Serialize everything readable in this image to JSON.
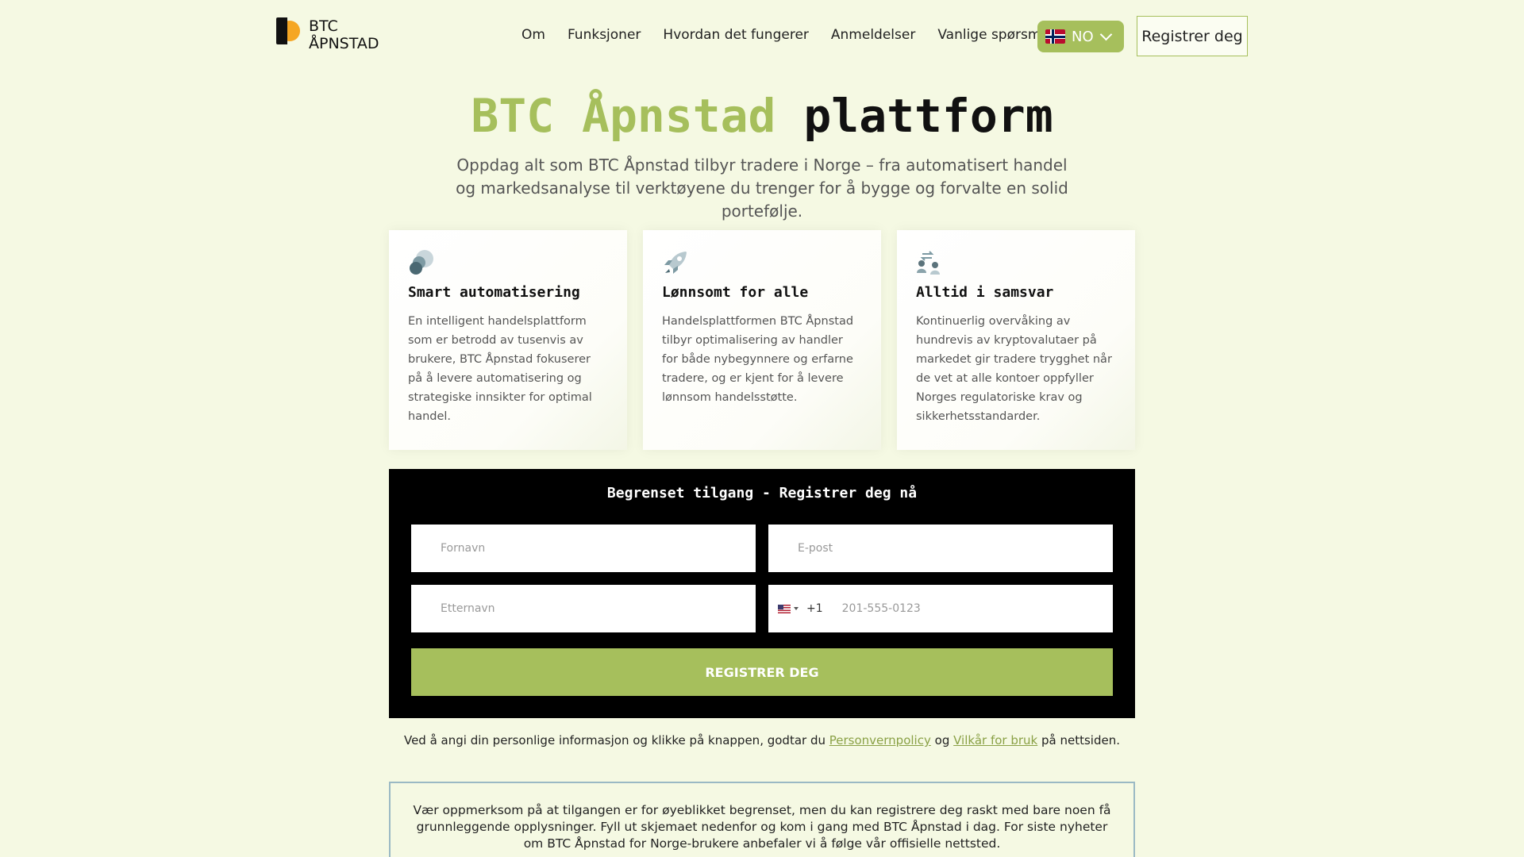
{
  "header": {
    "logo_line1": "BTC",
    "logo_line2": "ÅPNSTAD",
    "nav": [
      "Om",
      "Funksjoner",
      "Hvordan det fungerer",
      "Anmeldelser",
      "Vanlige spørsmål"
    ],
    "language": "NO",
    "register_label": "Registrer deg"
  },
  "hero": {
    "title_accent": "BTC Åpnstad",
    "title_rest": "plattform",
    "subtitle": "Oppdag alt som BTC Åpnstad tilbyr tradere i Norge – fra automatisert handel og markedsanalyse til verktøyene du trenger for å bygge og forvalte en solid portefølje."
  },
  "cards": [
    {
      "icon": "spheres-icon",
      "title": "Smart automatisering",
      "text": "En intelligent handelsplattform som er betrodd av tusenvis av brukere, BTC Åpnstad fokuserer på å levere automatisering og strategiske innsikter for optimal handel."
    },
    {
      "icon": "rocket-icon",
      "title": "Lønnsomt for alle",
      "text": "Handelsplattformen BTC Åpnstad tilbyr optimalisering av handler for både nybegynnere og erfarne tradere, og er kjent for å levere lønnsom handelsstøtte."
    },
    {
      "icon": "exchange-users-icon",
      "title": "Alltid i samsvar",
      "text": "Kontinuerlig overvåking av hundrevis av kryptovalutaer på markedet gir tradere trygghet når de vet at alle kontoer oppfyller Norges regulatoriske krav og sikkerhetsstandarder."
    }
  ],
  "form": {
    "title": "Begrenset tilgang - Registrer deg nå",
    "first_name_placeholder": "Fornavn",
    "email_placeholder": "E-post",
    "last_name_placeholder": "Etternavn",
    "dial_code": "+1",
    "phone_placeholder": "201-555-0123",
    "submit_label": "REGISTRER DEG"
  },
  "consent": {
    "before": "Ved å angi din personlige informasjon og klikke på knappen, godtar du",
    "privacy_link": "Personvernpolicy",
    "and": "og",
    "terms_link": "Vilkår for bruk",
    "after": "på nettsiden."
  },
  "notice": {
    "text": "Vær oppmerksom på at tilgangen er for øyeblikket begrenset, men du kan registrere deg raskt med bare noen få grunnleggende opplysninger. Fyll ut skjemaet nedenfor og kom i gang med BTC Åpnstad i dag. For siste nyheter om BTC Åpnstad for Norge-brukere anbefaler vi å følge vår offisielle nettsted."
  },
  "colors": {
    "accent": "#a6bf5c",
    "background": "#f5f9e3",
    "notice_border": "#9ab9c4"
  }
}
